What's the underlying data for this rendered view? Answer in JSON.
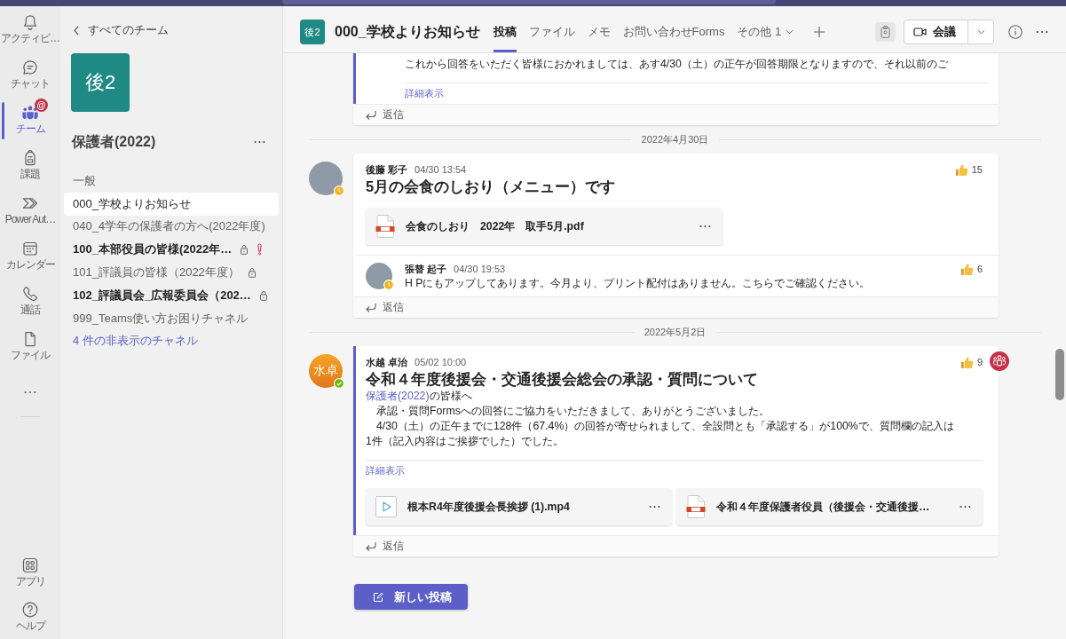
{
  "app_bar": {
    "items": [
      {
        "label": "アクティビ…",
        "selected": false
      },
      {
        "label": "チャット",
        "selected": false
      },
      {
        "label": "チーム",
        "selected": true,
        "badge": "@"
      },
      {
        "label": "課題",
        "selected": false
      },
      {
        "label": "Power Aut…",
        "selected": false
      },
      {
        "label": "カレンダー",
        "selected": false
      },
      {
        "label": "通話",
        "selected": false
      },
      {
        "label": "ファイル",
        "selected": false
      }
    ],
    "bottom_items": [
      {
        "label": "アプリ",
        "selected": false
      },
      {
        "label": "ヘルプ",
        "selected": false
      }
    ]
  },
  "sidebar": {
    "back_link": "すべてのチーム",
    "team": {
      "avatar": "後2",
      "name": "保護者(2022)"
    },
    "channels": [
      {
        "name": "一般",
        "selected": false,
        "unread": false,
        "locked": false,
        "alert": false
      },
      {
        "name": "000_学校よりお知らせ",
        "selected": true,
        "unread": false,
        "locked": false,
        "alert": false
      },
      {
        "name": "040_4学年の保護者の方へ(2022年度)",
        "selected": false,
        "unread": false,
        "locked": false,
        "alert": false
      },
      {
        "name": "100_本部役員の皆様(2022年…",
        "selected": false,
        "unread": true,
        "locked": true,
        "alert": true
      },
      {
        "name": "101_評議員の皆様（2022年度）",
        "selected": false,
        "unread": false,
        "locked": true,
        "alert": false
      },
      {
        "name": "102_評議員会_広報委員会（202…",
        "selected": false,
        "unread": true,
        "locked": true,
        "alert": false
      },
      {
        "name": "999_Teams使い方お困りチャネル",
        "selected": false,
        "unread": false,
        "locked": false,
        "alert": false
      }
    ],
    "hidden_channels_link": "4 件の非表示のチャネル"
  },
  "header": {
    "avatar": "後2",
    "title": "000_学校よりお知らせ",
    "tabs": [
      {
        "label": "投稿",
        "selected": true,
        "kind": "tab"
      },
      {
        "label": "ファイル",
        "selected": false,
        "kind": "tab"
      },
      {
        "label": "メモ",
        "selected": false,
        "kind": "tab"
      },
      {
        "label": "お問い合わせForms",
        "selected": false,
        "kind": "tab"
      },
      {
        "label": "その他 1",
        "selected": false,
        "kind": "menu"
      }
    ],
    "meet_button": "会議"
  },
  "feed": [
    {
      "kind": "post",
      "highlighted": true,
      "replies": [
        {
          "body": [
            {
              "text": "これから回答をいただく皆様におかれましては、あす4/30（土）の正午が回答期限となりますので、それ以前のご"
            }
          ],
          "see_more": "詳細表示"
        }
      ],
      "reply_label": "返信"
    },
    {
      "kind": "date",
      "label": "2022年4月30日"
    },
    {
      "kind": "post",
      "highlighted": false,
      "author": "後藤 彩子",
      "avatar": {
        "kind": "photo",
        "status": {
          "kind": "away",
          "color": "#f2b323"
        }
      },
      "time": "04/30 13:54",
      "likes": "15",
      "subject": "5月の会食のしおり（メニュー）です",
      "attachments": [
        {
          "kind": "pdf",
          "name": "会食のしおり　2022年　取手5月.pdf"
        }
      ],
      "replies": [
        {
          "author": "張替 起子",
          "avatar": {
            "kind": "photo",
            "status": {
              "kind": "away",
              "color": "#f2b323"
            }
          },
          "time": "04/30 19:53",
          "likes": "6",
          "body": [
            {
              "text": "H Pにもアップしてあります。今月より、プリント配付はありません。こちらでご確認ください。"
            }
          ]
        }
      ],
      "reply_label": "返信"
    },
    {
      "kind": "date",
      "label": "2022年5月2日"
    },
    {
      "kind": "post",
      "highlighted": true,
      "team_mention": true,
      "author": "水越 卓治",
      "avatar": {
        "kind": "initials",
        "text": "水卓",
        "status": {
          "kind": "available",
          "color": "#6bb700"
        }
      },
      "time": "05/02 10:00",
      "likes": "9",
      "subject": "令和４年度後援会・交通後援会総会の承認・質問について",
      "body": [
        {
          "mention": "保護者(2022)",
          "text": "の皆様へ"
        },
        {
          "text": "　承認・質問Formsへの回答にご協力をいただきまして、ありがとうございました。"
        },
        {
          "text": "　4/30（土）の正午までに128件（67.4%）の回答が寄せられまして、全設問とも「承認する」が100%で、質問欄の記入は1件（記入内容はご挨拶でした）でした。"
        }
      ],
      "see_more": "詳細表示",
      "attachments": [
        {
          "kind": "video",
          "name": "根本R4年度後援会長挨拶 (1).mp4"
        },
        {
          "kind": "pdf",
          "name": "令和４年度保護者役員（後援会・交通後援…"
        }
      ],
      "reply_label": "返信"
    }
  ],
  "new_post_button": "新しい投稿"
}
